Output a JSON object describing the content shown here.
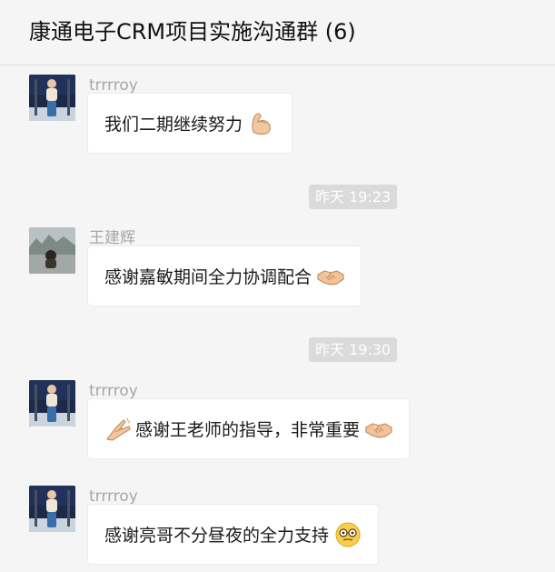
{
  "header": {
    "title": "康通电子CRM项目实施沟通群 (6)"
  },
  "messages": [
    {
      "sender": "trrrroy",
      "text": "我们二期继续努力",
      "emoji_after": "flexed-biceps-icon"
    },
    {
      "sender": "王建辉",
      "text": "感谢嘉敏期间全力协调配合",
      "emoji_after": "handshake-icon"
    },
    {
      "sender": "trrrroy",
      "text": "感谢王老师的指导，非常重要",
      "emoji_before": "clapping-hands-icon",
      "emoji_after": "handshake-icon"
    },
    {
      "sender": "trrrroy",
      "text": "感谢亮哥不分昼夜的全力支持",
      "emoji_after": "nerd-face-icon"
    }
  ],
  "timestamps": [
    "昨天 19:23",
    "昨天 19:30"
  ],
  "colors": {
    "background": "#f5f5f5",
    "bubble": "#ffffff",
    "timestamp_bg": "#dadada",
    "sender_name": "#a6a6a6"
  }
}
